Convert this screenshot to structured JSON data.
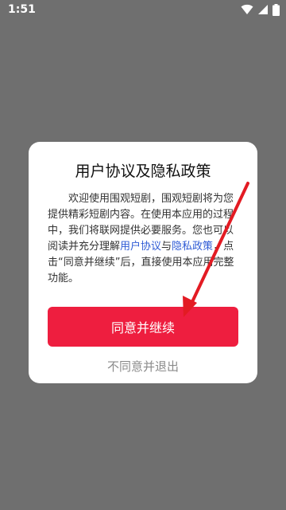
{
  "status_bar": {
    "time": "1:51",
    "icons": [
      "wifi-icon",
      "signal-icon",
      "battery-icon"
    ]
  },
  "dialog": {
    "title": "用户协议及隐私政策",
    "body_intro": "欢迎使用围观短剧，围观短剧将为您提供精彩短剧内容。在使用本应用的过程中，我们将联网提供必要服务。您也可以阅读并充分理解",
    "user_agreement_link": "用户协议",
    "and": "与",
    "privacy_link": "隐私政策",
    "body_outro": "，点击“同意并继续”后，直接使用本应用完整功能。",
    "agree_button": "同意并继续",
    "disagree_link": "不同意并退出"
  },
  "colors": {
    "overlay": "#6f6f6f",
    "accent": "#ee1e3f",
    "link": "#2f5bd5",
    "annotation_arrow": "#e31b23"
  }
}
